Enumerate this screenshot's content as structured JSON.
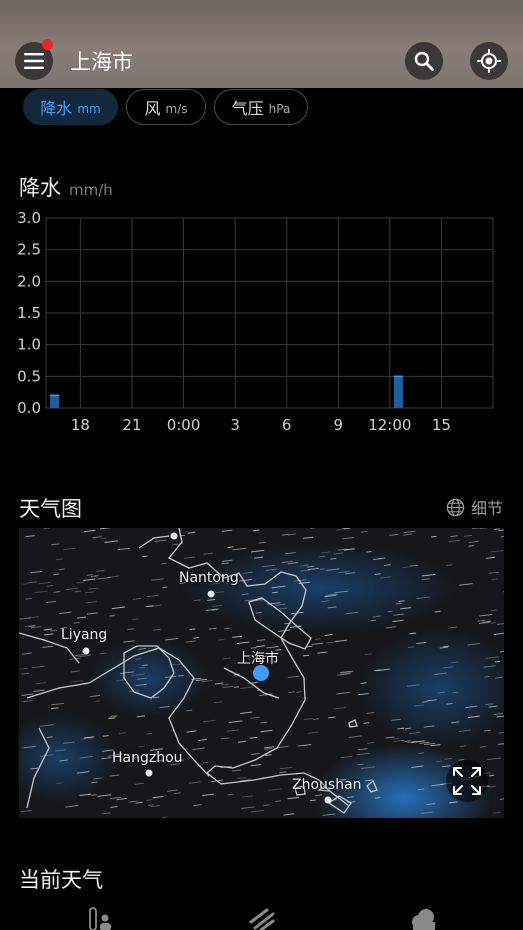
{
  "header": {
    "city": "上海市",
    "notification": true
  },
  "tabs": [
    {
      "label": "降水",
      "unit": "mm",
      "active": true
    },
    {
      "label": "风",
      "unit": "m/s",
      "active": false
    },
    {
      "label": "气压",
      "unit": "hPa",
      "active": false
    }
  ],
  "precipitation": {
    "title": "降水",
    "unit": "mm/h"
  },
  "chart_data": {
    "type": "bar",
    "title": "降水",
    "ylabel": "mm/h",
    "y_ticks": [
      "3.0",
      "2.5",
      "2.0",
      "1.5",
      "1.0",
      "0.5",
      "0.0"
    ],
    "x_ticks": [
      "18",
      "21",
      "0:00",
      "3",
      "6",
      "9",
      "12:00",
      "15"
    ],
    "ylim": [
      0,
      3.0
    ],
    "grid": true,
    "bars": [
      {
        "time": "12:30",
        "value": 0.5
      },
      {
        "time": "16:30",
        "value": 0.2
      }
    ],
    "colors": {
      "bar": "#1f5f9e",
      "grid": "#3a3a3a"
    }
  },
  "weather_map": {
    "title": "天气图",
    "details_label": "细节",
    "places": [
      "Nantong",
      "Liyang",
      "上海市",
      "Hangzhou",
      "Zhoushan"
    ]
  },
  "current_weather": {
    "title": "当前天气"
  },
  "colors": {
    "accent": "#3f9dfa",
    "header": "#7f7470",
    "background": "#000000"
  }
}
